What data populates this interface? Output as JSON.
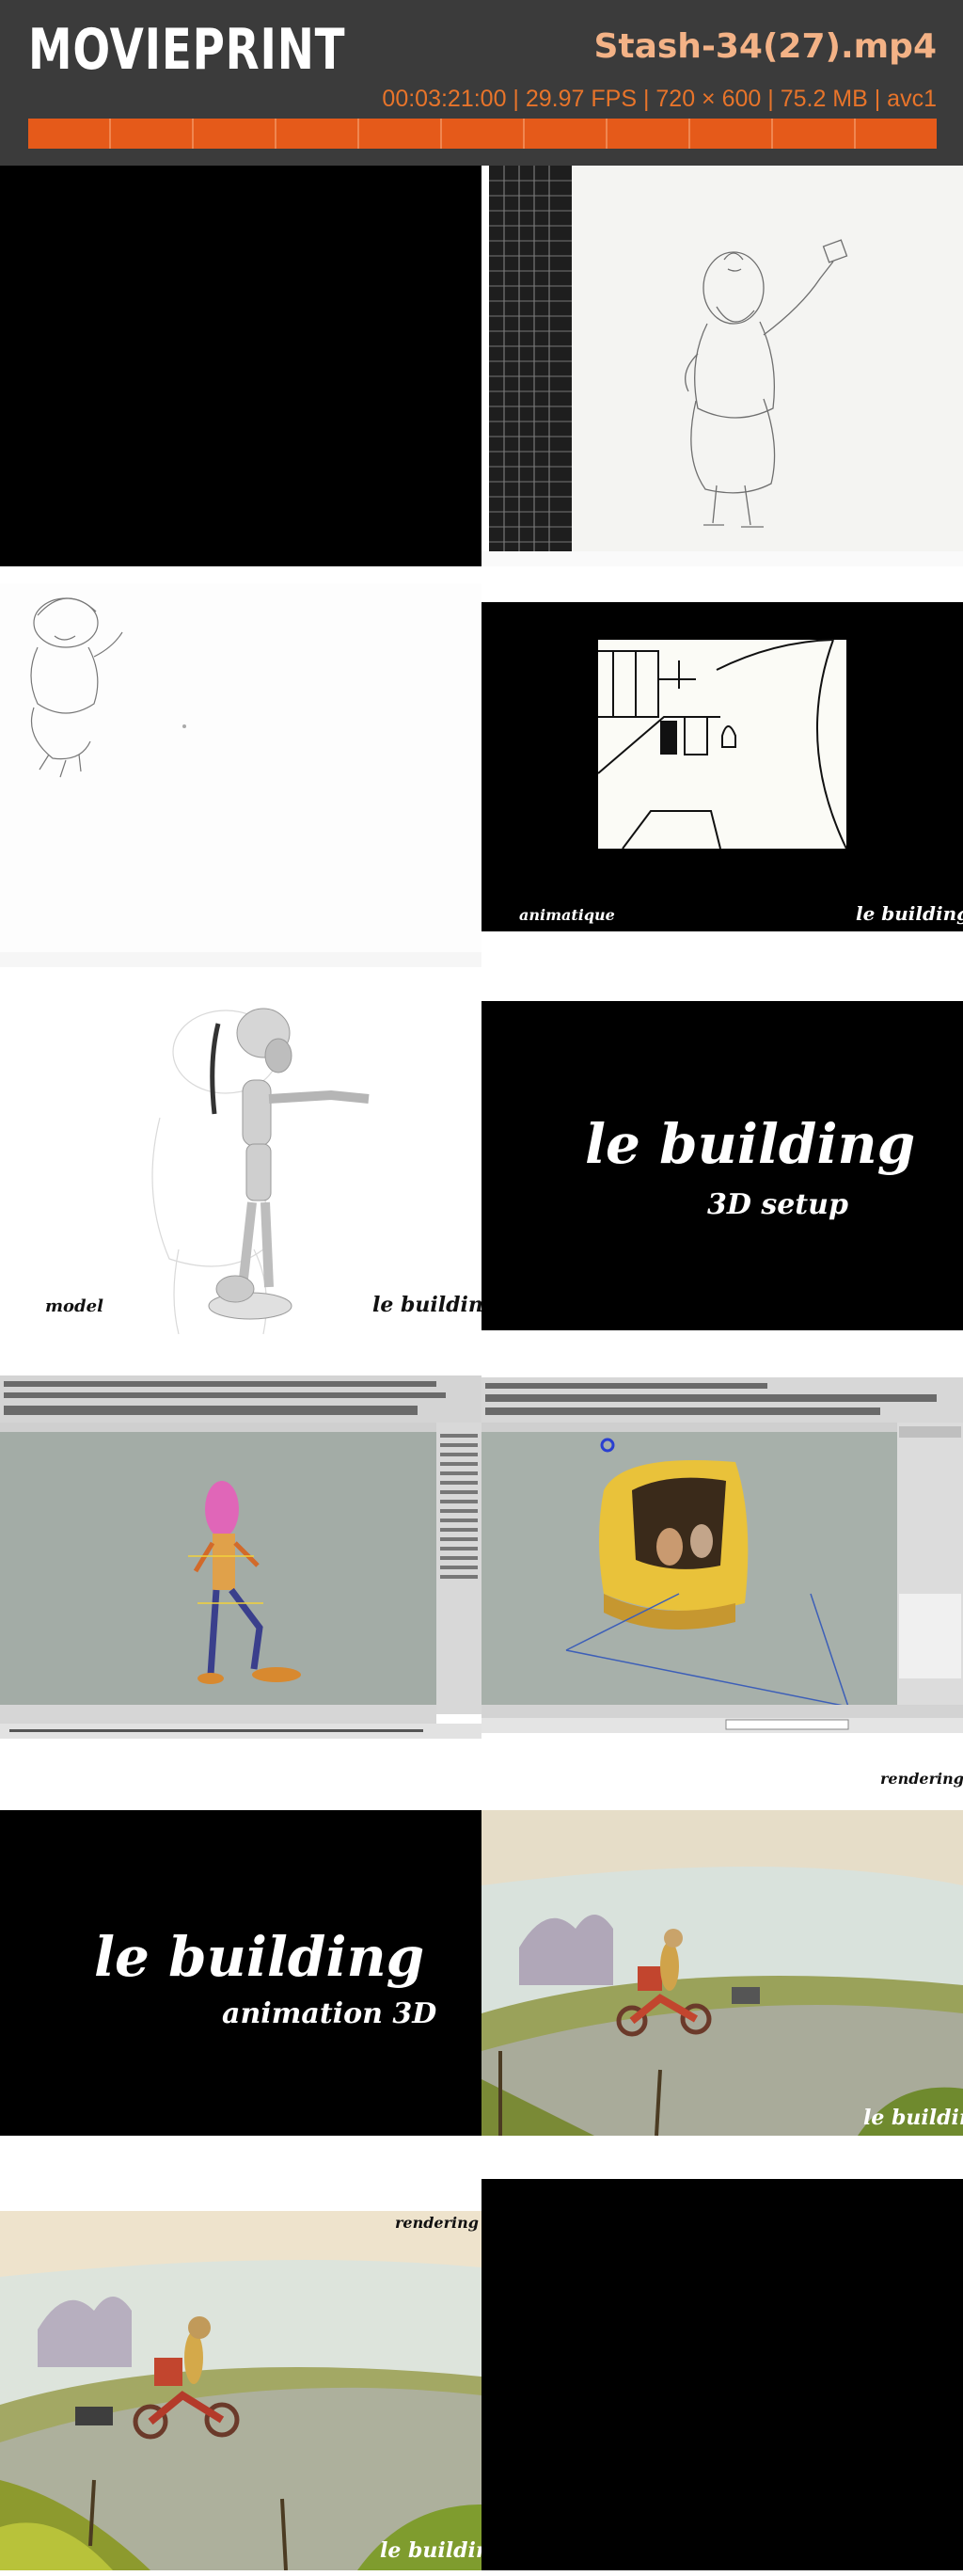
{
  "header": {
    "logo": "MOVIEPRINT",
    "filename": "Stash-34(27).mp4",
    "meta": "00:03:21:00 | 29.97 FPS | 720 × 600 | 75.2 MB | avc1",
    "timeline_segments": 11
  },
  "colors": {
    "header_bg": "#3b3b3b",
    "accent": "#e55a1a",
    "filename": "#f3b286",
    "meta": "#e8742a"
  },
  "frames": [
    {
      "id": 1,
      "kind": "black-frame"
    },
    {
      "id": 2,
      "kind": "pencil-sketch-grid"
    },
    {
      "id": 3,
      "kind": "pencil-sketch"
    },
    {
      "id": 4,
      "kind": "storyboard-line-art",
      "caption_left": "animatique",
      "caption_right": "le building"
    },
    {
      "id": 5,
      "kind": "3d-model-render",
      "caption_left": "model",
      "caption_right": "le building"
    },
    {
      "id": 6,
      "kind": "title-card",
      "title": "le building",
      "subtitle": "3D setup"
    },
    {
      "id": 7,
      "kind": "3d-software-rig"
    },
    {
      "id": 8,
      "kind": "3d-software-bus"
    },
    {
      "id": 9,
      "kind": "title-card",
      "title": "le building",
      "subtitle": "animation 3D"
    },
    {
      "id": 10,
      "kind": "rendered-scene",
      "caption_top": "rendering",
      "caption_bottom": "le building"
    },
    {
      "id": 11,
      "kind": "rendered-scene",
      "caption_top": "rendering",
      "caption_bottom": "le building"
    },
    {
      "id": 12,
      "kind": "black-frame"
    }
  ]
}
